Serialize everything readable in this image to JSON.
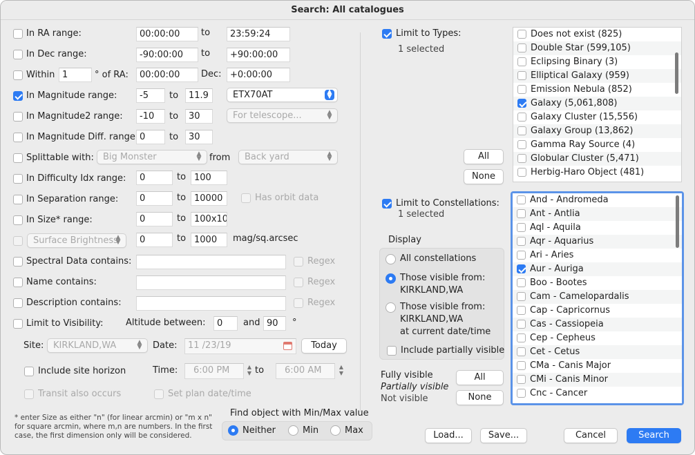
{
  "window": {
    "title": "Search: All catalogues"
  },
  "left": {
    "ra": {
      "label": "In RA range:",
      "from": "00:00:00",
      "to_label": "to",
      "to": "23:59:24",
      "checked": false
    },
    "dec": {
      "label": "In Dec range:",
      "from": "-90:00:00",
      "to_label": "to",
      "to": "+90:00:00",
      "checked": false
    },
    "within": {
      "label": "Within",
      "value": "1",
      "deg_label": "° of RA:",
      "ra": "00:00:00",
      "dec_label": "Dec:",
      "dec": "+0:00:00",
      "checked": false
    },
    "mag": {
      "label": "In Magnitude range:",
      "from": "-5",
      "to_label": "to",
      "to": "11.9",
      "popup": "ETX70AT",
      "checked": true
    },
    "mag2": {
      "label": "In Magnitude2 range:",
      "from": "-10",
      "to_label": "to",
      "to": "30",
      "popup": "For telescope...",
      "checked": false
    },
    "magdiff": {
      "label": "In Magnitude Diff. range:",
      "from": "0",
      "to_label": "to",
      "to": "30",
      "checked": false
    },
    "split": {
      "label": "Splittable with:",
      "popup": "Big Monster",
      "from_label": "from",
      "popup2": "Back yard",
      "checked": false
    },
    "difficulty": {
      "label": "In Difficulty Idx range:",
      "from": "0",
      "to_label": "to",
      "to": "100",
      "checked": false
    },
    "separation": {
      "label": "In Separation range:",
      "from": "0",
      "to_label": "to",
      "to": "10000",
      "orbit_label": "Has orbit data",
      "checked": false
    },
    "size": {
      "label": "In Size* range:",
      "from": "0",
      "to_label": "to",
      "to": "100x100",
      "checked": false
    },
    "surface": {
      "popup": "Surface Brightness",
      "from": "0",
      "to_label": "to",
      "to": "1000",
      "unit": "mag/sq.arcsec",
      "checked": false
    },
    "spectral": {
      "label": "Spectral Data contains:",
      "regex": "Regex",
      "checked": false
    },
    "name": {
      "label": "Name contains:",
      "regex": "Regex",
      "checked": false
    },
    "description": {
      "label": "Description contains:",
      "regex": "Regex",
      "checked": false
    },
    "visibility": {
      "label": "Limit to Visibility:",
      "alt_label": "Altitude between:",
      "alt_from": "0",
      "and_label": "and",
      "alt_to": "90",
      "deg": "°",
      "checked": false
    },
    "site": {
      "label": "Site:",
      "popup": "KIRKLAND,WA",
      "date_label": "Date:",
      "date": "11 /23/19",
      "today": "Today"
    },
    "horizon": {
      "label": "Include site horizon",
      "time_label": "Time:",
      "time_from": "6:00 PM",
      "to_label": "to",
      "time_to": "6:00 AM",
      "checked": false
    },
    "transit": {
      "label": "Transit also occurs",
      "plan": "Set plan date/time"
    },
    "footnote": "* enter Size as either \"n\" (for linear arcmin) or \"m x n\" for square arcmin, where m,n are numbers. In the first case, the first dimension only will be considered.",
    "minmax": {
      "title": "Find object with Min/Max value",
      "options": [
        "Neither",
        "Min",
        "Max"
      ],
      "selected": "Neither"
    }
  },
  "types": {
    "label": "Limit to Types:",
    "checked": true,
    "count": "1 selected",
    "all": "All",
    "none": "None",
    "items": [
      {
        "label": "Does not exist (825)",
        "checked": false
      },
      {
        "label": "Double Star (599,105)",
        "checked": false
      },
      {
        "label": "Eclipsing Binary (3)",
        "checked": false
      },
      {
        "label": "Elliptical Galaxy (959)",
        "checked": false
      },
      {
        "label": "Emission Nebula (852)",
        "checked": false
      },
      {
        "label": "Galaxy (5,061,808)",
        "checked": true
      },
      {
        "label": "Galaxy Cluster (15,556)",
        "checked": false
      },
      {
        "label": "Galaxy Group (13,862)",
        "checked": false
      },
      {
        "label": "Gamma Ray Source (4)",
        "checked": false
      },
      {
        "label": "Globular Cluster (5,471)",
        "checked": false
      },
      {
        "label": "Herbig-Haro Object (481)",
        "checked": false
      }
    ]
  },
  "constellations": {
    "label": "Limit to Constellations:",
    "checked": true,
    "count": "1 selected",
    "display_label": "Display",
    "options": [
      "All constellations",
      "Those visible from:\nKIRKLAND,WA",
      "Those visible from:\nKIRKLAND,WA\nat current date/time"
    ],
    "selected": "Those visible from:\nKIRKLAND,WA",
    "partial_label": "Include partially visible",
    "legend": {
      "fully": "Fully visible",
      "partially": "Partially visible",
      "not": "Not visible"
    },
    "all": "All",
    "none": "None",
    "items": [
      {
        "label": "And - Andromeda",
        "checked": false
      },
      {
        "label": "Ant - Antlia",
        "checked": false
      },
      {
        "label": "Aql - Aquila",
        "checked": false
      },
      {
        "label": "Aqr - Aquarius",
        "checked": false
      },
      {
        "label": "Ari - Aries",
        "checked": false
      },
      {
        "label": "Aur - Auriga",
        "checked": true
      },
      {
        "label": "Boo - Bootes",
        "checked": false
      },
      {
        "label": "Cam - Camelopardalis",
        "checked": false
      },
      {
        "label": "Cap - Capricornus",
        "checked": false
      },
      {
        "label": "Cas - Cassiopeia",
        "checked": false
      },
      {
        "label": "Cep - Cepheus",
        "checked": false
      },
      {
        "label": "Cet - Cetus",
        "checked": false
      },
      {
        "label": "CMa - Canis Major",
        "checked": false
      },
      {
        "label": "CMi - Canis Minor",
        "checked": false
      },
      {
        "label": "Cnc - Cancer",
        "checked": false
      }
    ]
  },
  "buttons": {
    "load": "Load...",
    "save": "Save...",
    "cancel": "Cancel",
    "search": "Search"
  },
  "colors": {
    "accent": "#2d7bf3",
    "focus_ring": "#5b93e8"
  }
}
